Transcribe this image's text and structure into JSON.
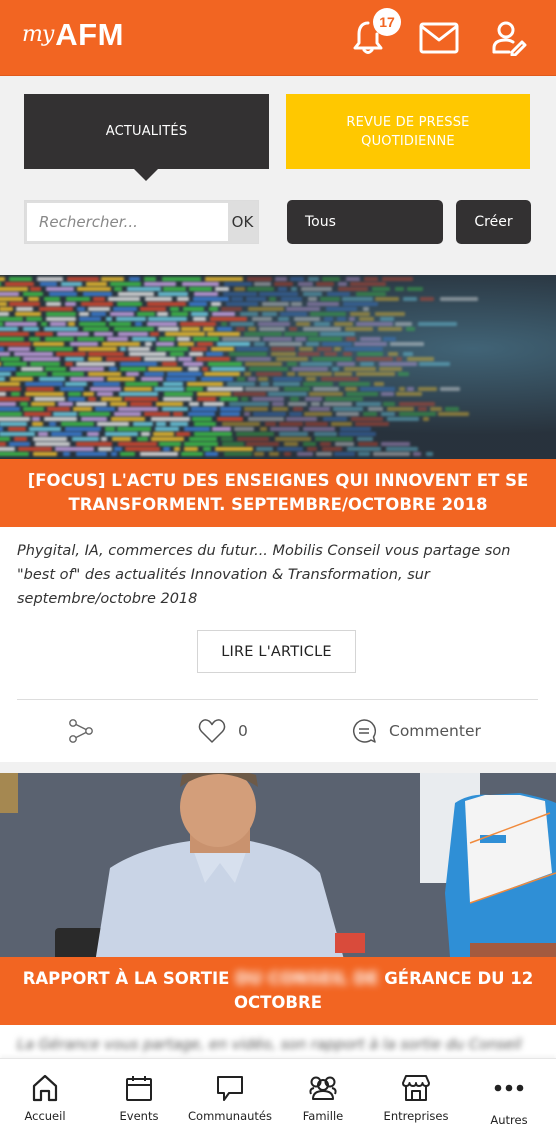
{
  "header": {
    "logo_prefix": "my",
    "logo_name": "AFM",
    "notification_count": "17",
    "icons": [
      "bell-icon",
      "mail-icon",
      "profile-edit-icon"
    ],
    "brand_color": "#f26522"
  },
  "tabs": [
    {
      "label": "ACTUALITÉS",
      "active": true,
      "color": "#333132"
    },
    {
      "label": "REVUE DE PRESSE QUOTIDIENNE",
      "active": false,
      "color": "#ffc800"
    }
  ],
  "search": {
    "placeholder": "Rechercher...",
    "value": "",
    "submit_label": "OK"
  },
  "filter": {
    "selected": "Tous"
  },
  "create_label": "Créer",
  "posts": [
    {
      "image": "code-screen-photo",
      "title": "[FOCUS] L'ACTU DES ENSEIGNES QUI INNOVENT ET SE TRANSFORMENT. SEPTEMBRE/OCTOBRE 2018",
      "description": "Phygital, IA, commerces du futur... Mobilis Conseil vous partage son \"best of\" des actualités Innovation & Transformation, sur septembre/octobre 2018",
      "read_label": "LIRE L'ARTICLE",
      "likes": "0",
      "comment_label": "Commenter"
    },
    {
      "image": "man-at-desk-photo",
      "title_start": "RAPPORT À LA SORTIE",
      "title_blurred": "DU CONSEIL DE",
      "title_end": "GÉRANCE DU 12 OCTOBRE",
      "description_blurred": "La Gérance vous partage, en vidéo, son rapport à la sortie du Conseil"
    }
  ],
  "bottom_nav": [
    {
      "label": "Accueil",
      "icon": "home-icon"
    },
    {
      "label": "Events",
      "icon": "calendar-icon"
    },
    {
      "label": "Communautés",
      "icon": "chat-bubble-icon"
    },
    {
      "label": "Famille",
      "icon": "group-icon"
    },
    {
      "label": "Entreprises",
      "icon": "storefront-icon"
    },
    {
      "label": "Autres",
      "icon": "more-dots-icon"
    }
  ]
}
